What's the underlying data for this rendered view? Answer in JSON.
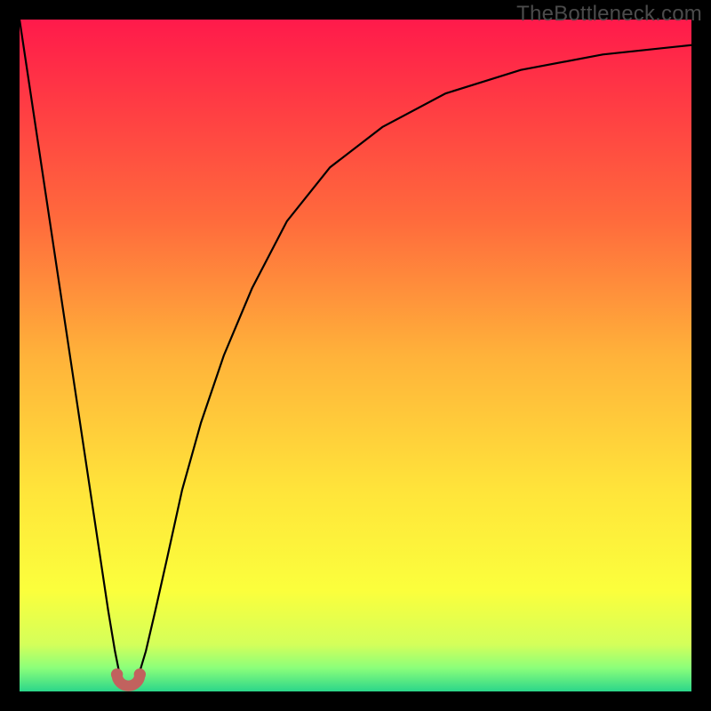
{
  "watermark": "TheBottleneck.com",
  "chart_data": {
    "type": "line",
    "title": "",
    "xlabel": "",
    "ylabel": "",
    "xlim": [
      0,
      100
    ],
    "ylim": [
      0,
      100
    ],
    "grid": false,
    "legend": false,
    "background_gradient": {
      "stops": [
        {
          "offset": 0.0,
          "color": "#ff1a4b"
        },
        {
          "offset": 0.12,
          "color": "#ff3a44"
        },
        {
          "offset": 0.3,
          "color": "#ff6b3c"
        },
        {
          "offset": 0.5,
          "color": "#ffb23a"
        },
        {
          "offset": 0.7,
          "color": "#ffe43a"
        },
        {
          "offset": 0.85,
          "color": "#fbff3c"
        },
        {
          "offset": 0.93,
          "color": "#d4ff5a"
        },
        {
          "offset": 0.965,
          "color": "#8bff7a"
        },
        {
          "offset": 1.0,
          "color": "#2bd68a"
        }
      ]
    },
    "series": [
      {
        "name": "bottleneck-curve",
        "color": "#000000",
        "width": 2.2,
        "x": [
          0.0,
          1.5,
          3.0,
          4.5,
          6.0,
          7.5,
          9.0,
          10.5,
          12.0,
          13.2,
          14.2,
          15.0,
          15.8,
          16.6,
          17.6,
          18.8,
          20.2,
          22.0,
          24.2,
          27.0,
          30.4,
          34.6,
          39.8,
          46.2,
          54.0,
          63.4,
          74.6,
          86.8,
          100.0
        ],
        "y": [
          100.0,
          90.0,
          80.0,
          70.0,
          60.0,
          50.0,
          40.0,
          30.0,
          20.0,
          12.0,
          6.0,
          2.0,
          0.4,
          0.4,
          2.0,
          6.0,
          12.0,
          20.0,
          30.0,
          40.0,
          50.0,
          60.0,
          70.0,
          78.0,
          84.0,
          89.0,
          92.5,
          94.8,
          96.2
        ]
      }
    ],
    "markers": [
      {
        "name": "sweet-spot-marker",
        "shape": "horseshoe",
        "color": "#c1625e",
        "x": 16.2,
        "y": 1.0,
        "size": 3.4
      }
    ]
  }
}
